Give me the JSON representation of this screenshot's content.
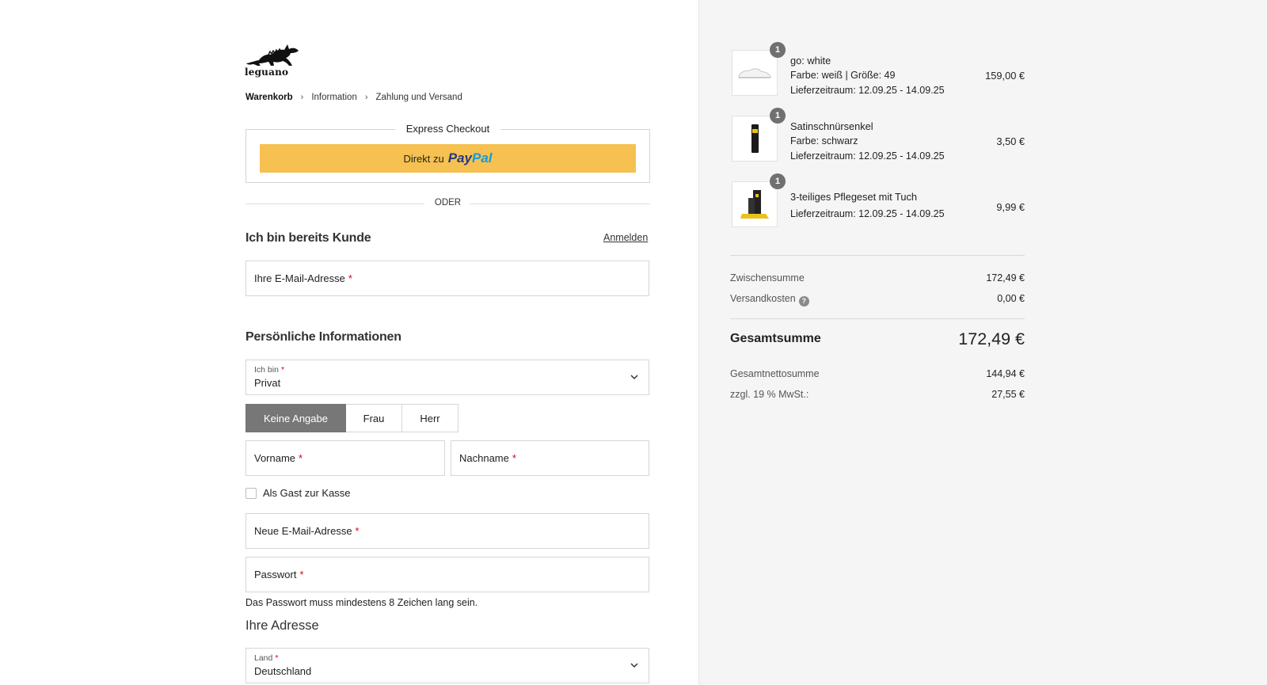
{
  "brand": {
    "logo_text": "leguano"
  },
  "breadcrumb": [
    {
      "label": "Warenkorb",
      "active": true
    },
    {
      "label": "Information",
      "active": false
    },
    {
      "label": "Zahlung und Versand",
      "active": false
    }
  ],
  "breadcrumb_sep": "›",
  "express": {
    "title": "Express Checkout",
    "paypal_prefix": "Direkt zu",
    "paypal_pay": "Pay",
    "paypal_pal": "Pal",
    "paypal_color": "#f6c151"
  },
  "divider_label": "ODER",
  "login": {
    "title": "Ich bin bereits Kunde",
    "link": "Anmelden",
    "email_placeholder": "Ihre E-Mail-Adresse",
    "required_mark": "*"
  },
  "personal": {
    "title": "Persönliche Informationen",
    "type_label": "Ich bin",
    "type_value": "Privat",
    "salutations": [
      {
        "label": "Keine Angabe",
        "active": true
      },
      {
        "label": "Frau",
        "active": false
      },
      {
        "label": "Herr",
        "active": false
      }
    ],
    "firstname_label": "Vorname",
    "lastname_label": "Nachname",
    "guest_label": "Als Gast zur Kasse",
    "new_email_label": "Neue E-Mail-Adresse",
    "password_label": "Passwort",
    "password_hint": "Das Passwort muss mindestens 8 Zeichen lang sein."
  },
  "address": {
    "title": "Ihre Adresse",
    "country_label": "Land",
    "country_value": "Deutschland"
  },
  "cart": {
    "items": [
      {
        "qty": "1",
        "name": "go: white",
        "details": [
          "Farbe: weiß | Größe: 49",
          "Lieferzeitraum: 12.09.25 - 14.09.25"
        ],
        "price": "159,00 €",
        "thumb_icon": "white-sneaker-icon"
      },
      {
        "qty": "1",
        "name": "Satinschnürsenkel",
        "details": [
          "Farbe: schwarz",
          "Lieferzeitraum: 12.09.25 - 14.09.25"
        ],
        "price": "3,50 €",
        "thumb_icon": "black-shoelace-icon"
      },
      {
        "qty": "1",
        "name": "3-teiliges Pflegeset mit Tuch",
        "details": [
          "Lieferzeitraum: 12.09.25 - 14.09.25"
        ],
        "price": "9,99 €",
        "thumb_icon": "care-set-icon"
      }
    ],
    "subtotal_label": "Zwischensumme",
    "subtotal": "172,49 €",
    "shipping_label": "Versandkosten",
    "shipping": "0,00 €",
    "total_label": "Gesamtsumme",
    "total": "172,49 €",
    "net_label": "Gesamtnettosumme",
    "net": "144,94 €",
    "tax_label": "zzgl. 19 % MwSt.:",
    "tax": "27,55 €"
  }
}
